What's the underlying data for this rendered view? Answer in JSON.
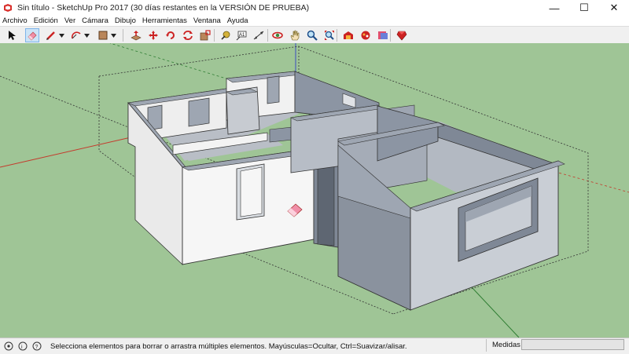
{
  "window": {
    "title": "Sin título - SketchUp Pro 2017 (30 días restantes en la VERSIÓN DE PRUEBA)",
    "controls": {
      "minimize": "—",
      "maximize": "☐",
      "close": "✕"
    }
  },
  "menu": {
    "items": [
      "Archivo",
      "Edición",
      "Ver",
      "Cámara",
      "Dibujo",
      "Herramientas",
      "Ventana",
      "Ayuda"
    ]
  },
  "toolbar": {
    "active_tool": "eraser",
    "tools": [
      "select",
      "eraser",
      "line",
      "arc",
      "shape",
      "push-pull",
      "move",
      "rotate",
      "scale",
      "tape-measure",
      "text",
      "orbit",
      "pan",
      "zoom",
      "zoom-extents",
      "warehouse",
      "extension-warehouse",
      "layout",
      "ruby"
    ]
  },
  "colors": {
    "ground": "#9fc596",
    "sky": "#ffffff",
    "wall_light": "#f4f4f4",
    "wall_gray": "#9ea6b2",
    "wall_dark": "#7f8896",
    "floor": "#b7bdc6",
    "red_axis": "#c43a2c",
    "green_axis": "#2e7d32",
    "blue_axis": "#3b4cc0",
    "active_tool_bg": "#cce4f7"
  },
  "statusbar": {
    "message": "Selecciona elementos para borrar o arrastra múltiples elementos. Mayúsculas=Ocultar, Ctrl=Suavizar/alisar.",
    "measure_label": "Medidas",
    "measure_value": ""
  }
}
